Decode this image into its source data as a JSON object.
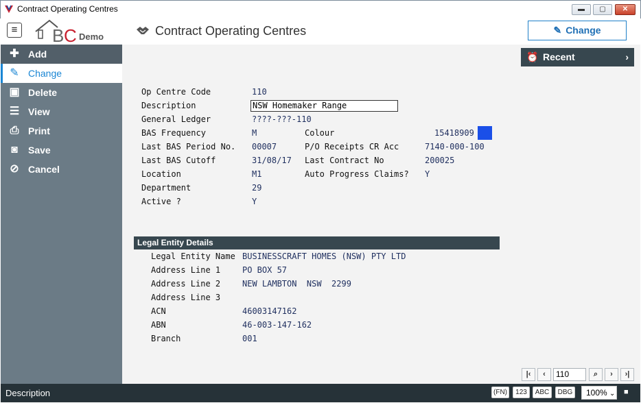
{
  "window": {
    "title": "Contract Operating Centres",
    "min_icon": "minimize-icon",
    "max_icon": "maximize-icon",
    "close_icon": "close-icon"
  },
  "header": {
    "logo_text": "BC",
    "logo_sub": "Demo",
    "page_title": "Contract Operating Centres",
    "change_button": "Change"
  },
  "sidebar": {
    "items": [
      {
        "label": "Add",
        "icon": "plus-icon"
      },
      {
        "label": "Change",
        "icon": "pencil-icon"
      },
      {
        "label": "Delete",
        "icon": "trash-icon"
      },
      {
        "label": "View",
        "icon": "list-icon"
      },
      {
        "label": "Print",
        "icon": "printer-icon"
      },
      {
        "label": "Save",
        "icon": "floppy-icon"
      },
      {
        "label": "Cancel",
        "icon": "cancel-icon"
      }
    ]
  },
  "recent": {
    "label": "Recent"
  },
  "form": {
    "op_centre_code": {
      "label": "Op Centre Code",
      "value": "110"
    },
    "description": {
      "label": "Description",
      "value": "NSW Homemaker Range"
    },
    "general_ledger": {
      "label": "General Ledger",
      "value": "????-???-110"
    },
    "bas_frequency": {
      "label": "BAS Frequency",
      "value": "M"
    },
    "last_bas_period": {
      "label": "Last BAS Period No.",
      "value": "00007"
    },
    "last_bas_cutoff": {
      "label": "Last BAS Cutoff",
      "value": "31/08/17"
    },
    "location": {
      "label": "Location",
      "value": "M1"
    },
    "department": {
      "label": "Department",
      "value": "29"
    },
    "active": {
      "label": "Active ?",
      "value": "Y"
    },
    "colour": {
      "label": "Colour",
      "value": "15418909",
      "swatch": "#1a4fe8"
    },
    "po_receipts": {
      "label": "P/O Receipts CR Acc",
      "value": "7140-000-100"
    },
    "last_contract": {
      "label": "Last Contract No",
      "value": "200025"
    },
    "auto_progress": {
      "label": "Auto Progress Claims?",
      "value": "Y"
    }
  },
  "legal": {
    "header": "Legal Entity Details",
    "entity_name": {
      "label": "Legal Entity Name",
      "value": "BUSINESSCRAFT HOMES (NSW) PTY LTD"
    },
    "address1": {
      "label": "Address Line 1",
      "value": "PO BOX 57"
    },
    "address2": {
      "label": "Address Line 2",
      "value": "NEW LAMBTON  NSW  2299"
    },
    "address3": {
      "label": "Address Line 3",
      "value": ""
    },
    "acn": {
      "label": "ACN",
      "value": "46003147162"
    },
    "abn": {
      "label": "ABN",
      "value": "46-003-147-162"
    },
    "branch": {
      "label": "Branch",
      "value": "001"
    }
  },
  "nav": {
    "record": "110"
  },
  "status": {
    "text": "Description",
    "fn": "(FN)",
    "num": "123",
    "abc": "ABC",
    "dbg": "DBG",
    "zoom": "100%"
  }
}
